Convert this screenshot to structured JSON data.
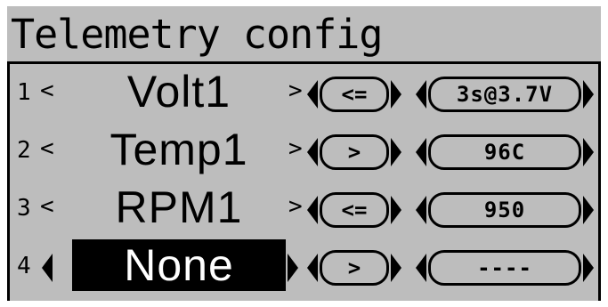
{
  "title": "Telemetry config",
  "rows": [
    {
      "index": "1",
      "name": "Volt1",
      "operator": "<=",
      "value": "3s@3.7V",
      "selected": false
    },
    {
      "index": "2",
      "name": "Temp1",
      "operator": ">",
      "value": "96C",
      "selected": false
    },
    {
      "index": "3",
      "name": "RPM1",
      "operator": "<=",
      "value": "950",
      "selected": false
    },
    {
      "index": "4",
      "name": "None",
      "operator": ">",
      "value": "----",
      "selected": true
    }
  ],
  "colors": {
    "background": "#bdbdbd",
    "foreground": "#000000",
    "highlight": "#000000",
    "highlight_text": "#ffffff"
  },
  "icons": {
    "prev": "left-chevron-icon",
    "next": "right-chevron-icon"
  }
}
